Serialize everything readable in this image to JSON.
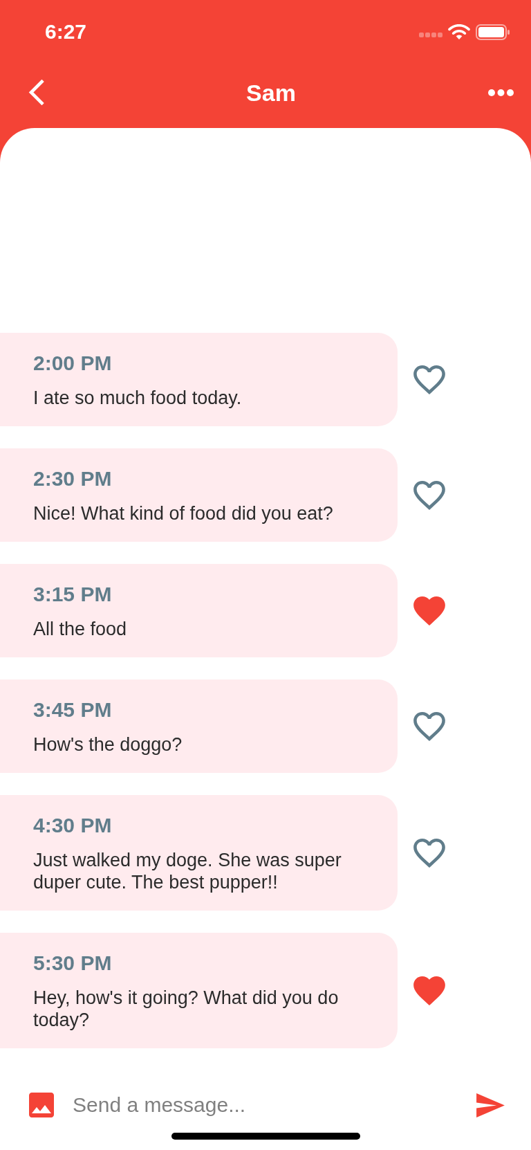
{
  "status_bar": {
    "time": "6:27"
  },
  "header": {
    "title": "Sam"
  },
  "messages": [
    {
      "time": "2:00 PM",
      "text": "I ate so much food today.",
      "liked": false
    },
    {
      "time": "2:30 PM",
      "text": "Nice! What kind of food did you eat?",
      "liked": false
    },
    {
      "time": "3:15 PM",
      "text": "All the food",
      "liked": true
    },
    {
      "time": "3:45 PM",
      "text": "How's the doggo?",
      "liked": false
    },
    {
      "time": "4:30 PM",
      "text": "Just walked my doge. She was super duper cute. The best pupper!!",
      "liked": false
    },
    {
      "time": "5:30 PM",
      "text": "Hey, how's it going? What did you do today?",
      "liked": true
    }
  ],
  "composer": {
    "placeholder": "Send a message..."
  }
}
